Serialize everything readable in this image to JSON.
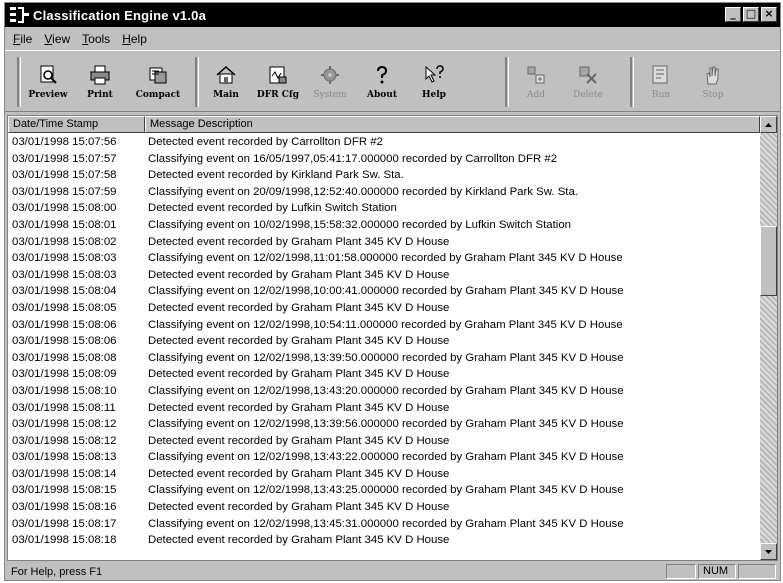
{
  "window": {
    "title": "Classification Engine v1.0a"
  },
  "title_buttons": {
    "minimize": "_",
    "maximize": "□",
    "close": "×"
  },
  "menu": [
    {
      "label": "File",
      "accel": "F",
      "rest": "ile"
    },
    {
      "label": "View",
      "accel": "V",
      "rest": "iew"
    },
    {
      "label": "Tools",
      "accel": "T",
      "rest": "ools"
    },
    {
      "label": "Help",
      "accel": "H",
      "rest": "elp"
    }
  ],
  "toolbar": {
    "preview": {
      "label": "Preview",
      "icon": "preview-icon"
    },
    "print": {
      "label": "Print",
      "icon": "printer-icon"
    },
    "compact": {
      "label": "Compact",
      "icon": "compact-icon"
    },
    "main": {
      "label": "Main",
      "icon": "house-icon"
    },
    "dfr_cfg": {
      "label": "DFR Cfg",
      "icon": "dfr-config-icon"
    },
    "system": {
      "label": "System",
      "icon": "gear-icon"
    },
    "about": {
      "label": "About",
      "icon": "question-icon"
    },
    "help": {
      "label": "Help",
      "icon": "help-pointer-icon"
    },
    "add": {
      "label": "Add",
      "icon": "add-icon"
    },
    "delete": {
      "label": "Delete",
      "icon": "delete-icon"
    },
    "run": {
      "label": "Run",
      "icon": "run-icon"
    },
    "stop": {
      "label": "Stop",
      "icon": "stop-hand-icon"
    }
  },
  "list": {
    "columns": [
      "Date/Time Stamp",
      "Message Description"
    ],
    "rows": [
      [
        "03/01/1998 15:07:56",
        "Detected event recorded by Carrollton DFR #2"
      ],
      [
        "03/01/1998 15:07:57",
        "Classifying event on 16/05/1997,05:41:17.000000 recorded by Carrollton DFR #2"
      ],
      [
        "03/01/1998 15:07:58",
        "Detected event recorded by Kirkland Park Sw. Sta."
      ],
      [
        "03/01/1998 15:07:59",
        "Classifying event on 20/09/1998,12:52:40.000000 recorded by Kirkland Park Sw. Sta."
      ],
      [
        "03/01/1998 15:08:00",
        "Detected event recorded by Lufkin Switch Station"
      ],
      [
        "03/01/1998 15:08:01",
        "Classifying event on 10/02/1998,15:58:32.000000 recorded by Lufkin Switch Station"
      ],
      [
        "03/01/1998 15:08:02",
        "Detected event recorded by Graham Plant 345 KV D House"
      ],
      [
        "03/01/1998 15:08:03",
        "Classifying event on 12/02/1998,11:01:58.000000 recorded by Graham Plant 345 KV D House"
      ],
      [
        "03/01/1998 15:08:03",
        "Detected event recorded by Graham Plant 345 KV D House"
      ],
      [
        "03/01/1998 15:08:04",
        "Classifying event on 12/02/1998,10:00:41.000000 recorded by Graham Plant 345 KV D House"
      ],
      [
        "03/01/1998 15:08:05",
        "Detected event recorded by Graham Plant 345 KV D House"
      ],
      [
        "03/01/1998 15:08:06",
        "Classifying event on 12/02/1998,10:54:11.000000 recorded by Graham Plant 345 KV D House"
      ],
      [
        "03/01/1998 15:08:06",
        "Detected event recorded by Graham Plant 345 KV D House"
      ],
      [
        "03/01/1998 15:08:08",
        "Classifying event on 12/02/1998,13:39:50.000000 recorded by Graham Plant 345 KV D House"
      ],
      [
        "03/01/1998 15:08:09",
        "Detected event recorded by Graham Plant 345 KV D House"
      ],
      [
        "03/01/1998 15:08:10",
        "Classifying event on 12/02/1998,13:43:20.000000 recorded by Graham Plant 345 KV D House"
      ],
      [
        "03/01/1998 15:08:11",
        "Detected event recorded by Graham Plant 345 KV D House"
      ],
      [
        "03/01/1998 15:08:12",
        "Classifying event on 12/02/1998,13:39:56.000000 recorded by Graham Plant 345 KV D House"
      ],
      [
        "03/01/1998 15:08:12",
        "Detected event recorded by Graham Plant 345 KV D House"
      ],
      [
        "03/01/1998 15:08:13",
        "Classifying event on 12/02/1998,13:43:22.000000 recorded by Graham Plant 345 KV D House"
      ],
      [
        "03/01/1998 15:08:14",
        "Detected event recorded by Graham Plant 345 KV D House"
      ],
      [
        "03/01/1998 15:08:15",
        "Classifying event on 12/02/1998,13:43:25.000000 recorded by Graham Plant 345 KV D House"
      ],
      [
        "03/01/1998 15:08:16",
        "Detected event recorded by Graham Plant 345 KV D House"
      ],
      [
        "03/01/1998 15:08:17",
        "Classifying event on 12/02/1998,13:45:31.000000 recorded by Graham Plant 345 KV D House"
      ],
      [
        "03/01/1998 15:08:18",
        "Detected event recorded by Graham Plant 345 KV D House"
      ]
    ]
  },
  "status": {
    "text": "For Help, press F1",
    "num": "NUM"
  }
}
